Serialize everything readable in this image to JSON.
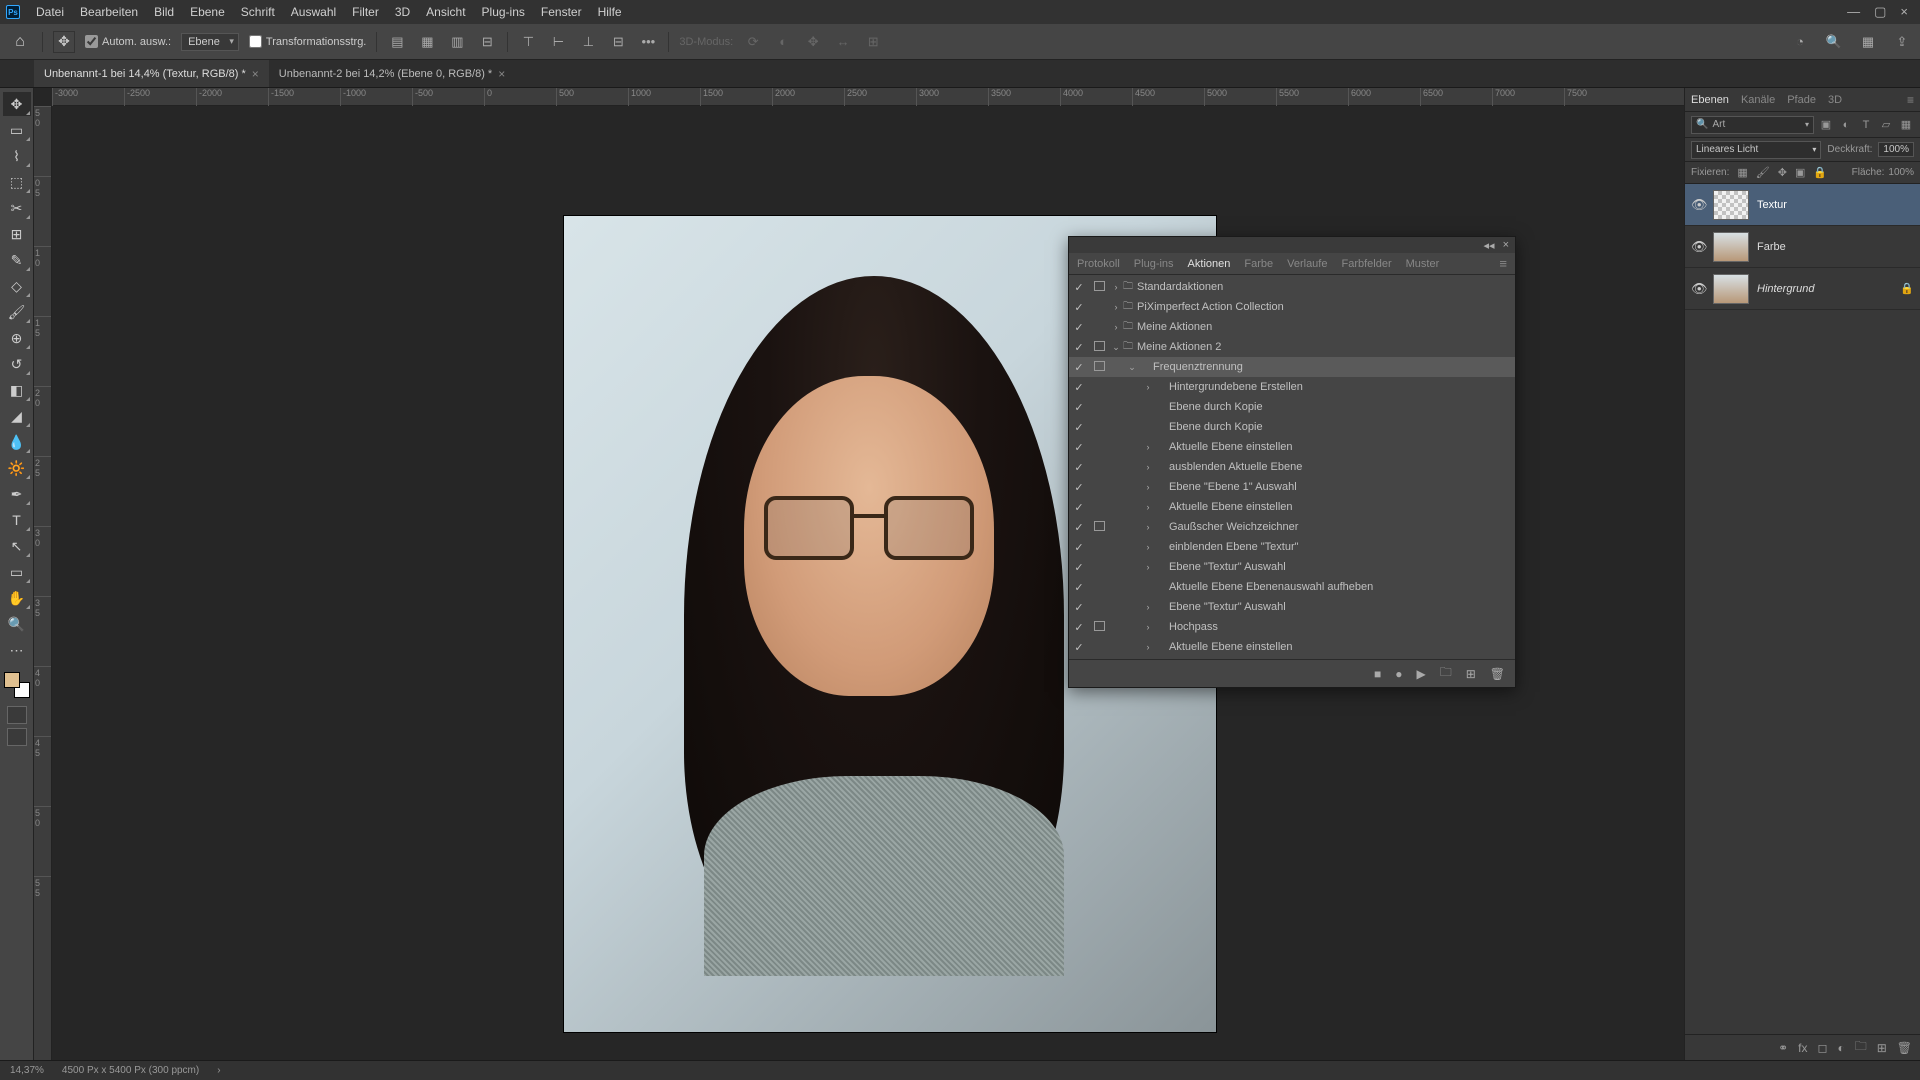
{
  "menubar": {
    "items": [
      "Datei",
      "Bearbeiten",
      "Bild",
      "Ebene",
      "Schrift",
      "Auswahl",
      "Filter",
      "3D",
      "Ansicht",
      "Plug-ins",
      "Fenster",
      "Hilfe"
    ]
  },
  "optionsbar": {
    "auto_select": "Autom. ausw.:",
    "layer_select": "Ebene",
    "transform_controls": "Transformationsstrg.",
    "three_d_mode": "3D-Modus:"
  },
  "doctabs": [
    {
      "title": "Unbenannt-1 bei 14,4% (Textur, RGB/8) *",
      "active": true
    },
    {
      "title": "Unbenannt-2 bei 14,2% (Ebene 0, RGB/8) *",
      "active": false
    }
  ],
  "ruler_h": [
    "-3000",
    "-2500",
    "-2000",
    "-1500",
    "-1000",
    "-500",
    "0",
    "500",
    "1000",
    "1500",
    "2000",
    "2500",
    "3000",
    "3500",
    "4000",
    "4500",
    "5000",
    "5500",
    "6000",
    "6500",
    "7000",
    "7500"
  ],
  "ruler_v": [
    "5",
    "0",
    "0",
    "5",
    "1",
    "0",
    "1",
    "5",
    "2",
    "0",
    "2",
    "5",
    "3",
    "0",
    "3",
    "5",
    "4",
    "0",
    "4",
    "5",
    "5",
    "0",
    "5",
    "5"
  ],
  "layers_panel": {
    "tabs": [
      "Ebenen",
      "Kanäle",
      "Pfade",
      "3D"
    ],
    "search_placeholder": "Art",
    "blend_mode": "Lineares Licht",
    "opacity_label": "Deckkraft:",
    "opacity_value": "100%",
    "lock_label": "Fixieren:",
    "fill_label": "Fläche:",
    "fill_value": "100%",
    "layers": [
      {
        "name": "Textur",
        "selected": true,
        "thumb": "grey",
        "locked": false,
        "italic": false
      },
      {
        "name": "Farbe",
        "selected": false,
        "thumb": "face",
        "locked": false,
        "italic": false
      },
      {
        "name": "Hintergrund",
        "selected": false,
        "thumb": "face",
        "locked": true,
        "italic": true
      }
    ]
  },
  "actions_panel": {
    "tabs": [
      "Protokoll",
      "Plug-ins",
      "Aktionen",
      "Farbe",
      "Verlaufe",
      "Farbfelder",
      "Muster"
    ],
    "active_tab": "Aktionen",
    "rows": [
      {
        "check": true,
        "dialog": true,
        "expand": "›",
        "folder": true,
        "indent": 0,
        "name": "Standardaktionen",
        "selected": false
      },
      {
        "check": true,
        "dialog": false,
        "expand": "›",
        "folder": true,
        "indent": 0,
        "name": "PiXimperfect Action Collection",
        "selected": false
      },
      {
        "check": true,
        "dialog": false,
        "expand": "›",
        "folder": true,
        "indent": 0,
        "name": "Meine Aktionen",
        "selected": false
      },
      {
        "check": true,
        "dialog": true,
        "expand": "⌄",
        "folder": true,
        "indent": 0,
        "name": "Meine Aktionen 2",
        "selected": false
      },
      {
        "check": true,
        "dialog": true,
        "expand": "⌄",
        "folder": false,
        "indent": 1,
        "name": "Frequenztrennung",
        "selected": true
      },
      {
        "check": true,
        "dialog": false,
        "expand": "›",
        "folder": false,
        "indent": 2,
        "name": "Hintergrundebene Erstellen",
        "selected": false
      },
      {
        "check": true,
        "dialog": false,
        "expand": "",
        "folder": false,
        "indent": 2,
        "name": "Ebene durch Kopie",
        "selected": false
      },
      {
        "check": true,
        "dialog": false,
        "expand": "",
        "folder": false,
        "indent": 2,
        "name": "Ebene durch Kopie",
        "selected": false
      },
      {
        "check": true,
        "dialog": false,
        "expand": "›",
        "folder": false,
        "indent": 2,
        "name": "Aktuelle Ebene einstellen",
        "selected": false
      },
      {
        "check": true,
        "dialog": false,
        "expand": "›",
        "folder": false,
        "indent": 2,
        "name": "ausblenden Aktuelle Ebene",
        "selected": false
      },
      {
        "check": true,
        "dialog": false,
        "expand": "›",
        "folder": false,
        "indent": 2,
        "name": "Ebene \"Ebene 1\" Auswahl",
        "selected": false
      },
      {
        "check": true,
        "dialog": false,
        "expand": "›",
        "folder": false,
        "indent": 2,
        "name": "Aktuelle Ebene einstellen",
        "selected": false
      },
      {
        "check": true,
        "dialog": true,
        "expand": "›",
        "folder": false,
        "indent": 2,
        "name": "Gaußscher Weichzeichner",
        "selected": false
      },
      {
        "check": true,
        "dialog": false,
        "expand": "›",
        "folder": false,
        "indent": 2,
        "name": "einblenden Ebene \"Textur\"",
        "selected": false
      },
      {
        "check": true,
        "dialog": false,
        "expand": "›",
        "folder": false,
        "indent": 2,
        "name": "Ebene \"Textur\" Auswahl",
        "selected": false
      },
      {
        "check": true,
        "dialog": false,
        "expand": "",
        "folder": false,
        "indent": 2,
        "name": "Aktuelle Ebene Ebenenauswahl aufheben",
        "selected": false
      },
      {
        "check": true,
        "dialog": false,
        "expand": "›",
        "folder": false,
        "indent": 2,
        "name": "Ebene \"Textur\" Auswahl",
        "selected": false
      },
      {
        "check": true,
        "dialog": true,
        "expand": "›",
        "folder": false,
        "indent": 2,
        "name": "Hochpass",
        "selected": false
      },
      {
        "check": true,
        "dialog": false,
        "expand": "›",
        "folder": false,
        "indent": 2,
        "name": "Aktuelle Ebene einstellen",
        "selected": false
      }
    ]
  },
  "statusbar": {
    "zoom": "14,37%",
    "doc_info": "4500 Px x 5400 Px (300 ppcm)"
  },
  "icons": {
    "search": "🔍",
    "home": "⌂",
    "move": "✥",
    "gear": "⚙",
    "close": "×",
    "minimize": "—",
    "maximize": "▢",
    "collapse": "◂◂"
  }
}
